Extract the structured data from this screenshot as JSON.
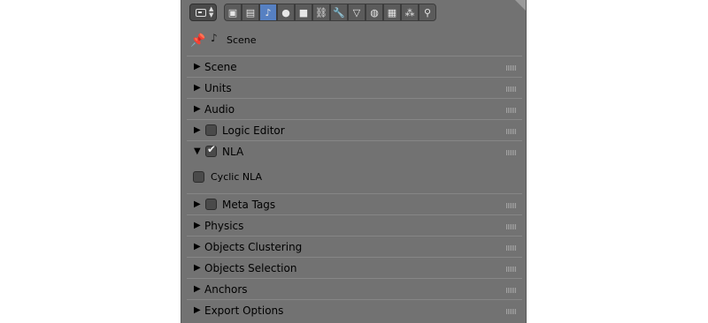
{
  "toolbar": {
    "tabs": [
      {
        "name": "render-icon",
        "glyph": "▣"
      },
      {
        "name": "render-layers-icon",
        "glyph": "▤"
      },
      {
        "name": "scene-icon",
        "glyph": "♪"
      },
      {
        "name": "world-icon",
        "glyph": "●"
      },
      {
        "name": "object-icon",
        "glyph": "■"
      },
      {
        "name": "constraints-icon",
        "glyph": "⛓"
      },
      {
        "name": "modifiers-icon",
        "glyph": "🔧"
      },
      {
        "name": "data-icon",
        "glyph": "▽"
      },
      {
        "name": "material-icon",
        "glyph": "◍"
      },
      {
        "name": "texture-icon",
        "glyph": "▦"
      },
      {
        "name": "particles-icon",
        "glyph": "⁂"
      },
      {
        "name": "physics-icon",
        "glyph": "⚲"
      }
    ]
  },
  "context": {
    "label": "Scene"
  },
  "panels": [
    {
      "label": "Scene"
    },
    {
      "label": "Units"
    },
    {
      "label": "Audio"
    },
    {
      "label": "Logic Editor"
    },
    {
      "label": "NLA"
    },
    {
      "label": "Meta Tags"
    },
    {
      "label": "Physics"
    },
    {
      "label": "Objects Clustering"
    },
    {
      "label": "Objects Selection"
    },
    {
      "label": "Anchors"
    },
    {
      "label": "Export Options"
    }
  ],
  "nla": {
    "cyclic_label": "Cyclic NLA"
  }
}
